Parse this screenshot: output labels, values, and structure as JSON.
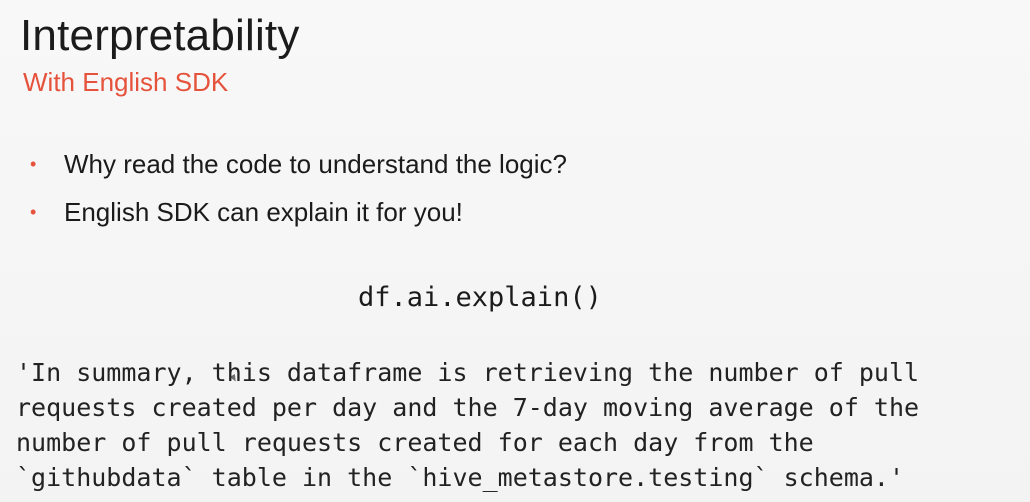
{
  "slide": {
    "title": "Interpretability",
    "subtitle": "With English SDK",
    "bullets": [
      "Why read the code to understand the logic?",
      "English SDK can explain it for you!"
    ],
    "code_call": "df.ai.explain()",
    "output_lines": [
      "'In summary, this dataframe is retrieving the number of pull",
      "requests created per day and the 7-day moving average of the",
      "number of pull requests created for each day from the",
      "`githubdata` table in the `hive_metastore.testing` schema.'"
    ]
  },
  "colors": {
    "accent": "#e5533c",
    "text": "#1b1b1b",
    "background": "#f7f7f7"
  },
  "icons": {
    "bullet": "bullet-dot-icon",
    "cursor": "mouse-cursor-icon"
  }
}
